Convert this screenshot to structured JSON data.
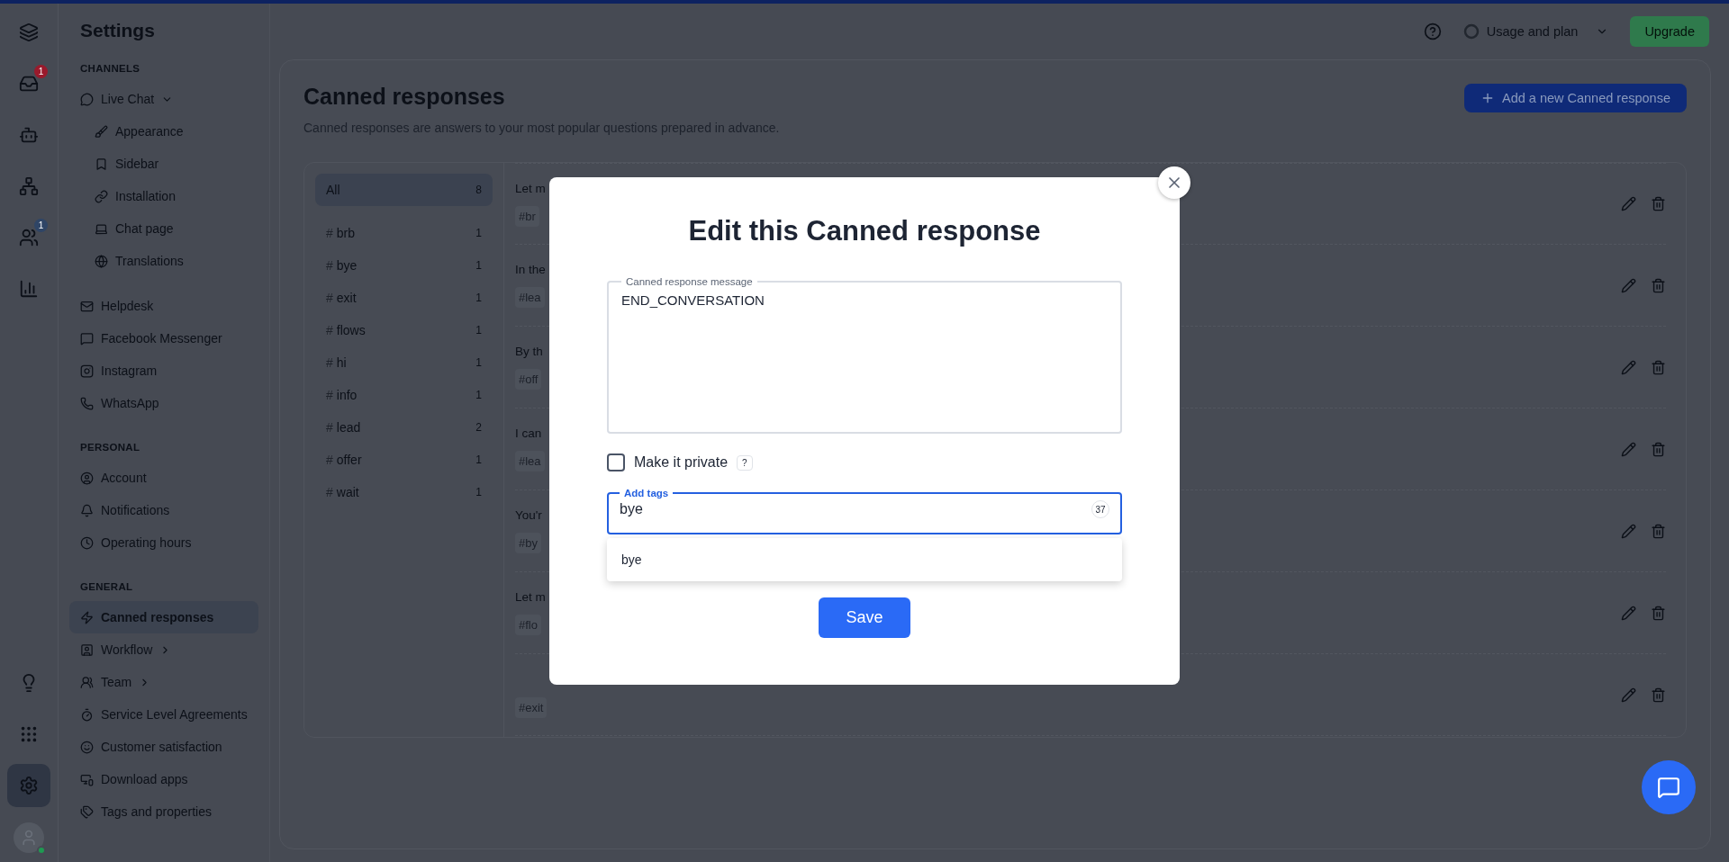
{
  "rail": {
    "top": [
      {
        "selected": false
      },
      {
        "selected": false,
        "badge": "1"
      },
      {
        "selected": false
      },
      {
        "selected": false
      },
      {
        "selected": false,
        "badge": "1"
      },
      {
        "selected": false
      }
    ],
    "bottom": [
      {
        "selected": false
      },
      {
        "selected": false
      },
      {
        "selected": true
      }
    ],
    "avatar": {
      "online": true
    }
  },
  "sidebar": {
    "title": "Settings",
    "sections": [
      {
        "heading": "CHANNELS",
        "items": [
          {
            "label": "Live Chat",
            "selected": false,
            "expanded": true,
            "children": [
              {
                "label": "Appearance",
                "selected": false
              },
              {
                "label": "Sidebar",
                "selected": false
              },
              {
                "label": "Installation",
                "selected": false
              },
              {
                "label": "Chat page",
                "selected": false
              },
              {
                "label": "Translations",
                "selected": false
              }
            ]
          },
          {
            "label": "Helpdesk",
            "selected": false
          },
          {
            "label": "Facebook Messenger",
            "selected": false
          },
          {
            "label": "Instagram",
            "selected": false
          },
          {
            "label": "WhatsApp",
            "selected": false
          }
        ]
      },
      {
        "heading": "PERSONAL",
        "items": [
          {
            "label": "Account",
            "selected": false
          },
          {
            "label": "Notifications",
            "selected": false
          },
          {
            "label": "Operating hours",
            "selected": false
          }
        ]
      },
      {
        "heading": "GENERAL",
        "items": [
          {
            "label": "Canned responses",
            "selected": true
          },
          {
            "label": "Workflow",
            "selected": false,
            "expanded": false
          },
          {
            "label": "Team",
            "selected": false,
            "expanded": false
          },
          {
            "label": "Service Level Agreements",
            "selected": false
          },
          {
            "label": "Customer satisfaction",
            "selected": false
          },
          {
            "label": "Download apps",
            "selected": false
          },
          {
            "label": "Tags and properties",
            "selected": false
          }
        ]
      }
    ]
  },
  "top_bar": {
    "usage": "Usage and plan",
    "upgrade": "Upgrade"
  },
  "page": {
    "title": "Canned responses",
    "subtitle": "Canned responses are answers to your most popular questions prepared in advance.",
    "add_button": "Add a new Canned response"
  },
  "tag_filters": [
    {
      "label": "All",
      "count": "8",
      "selected": true
    },
    {
      "prefix": "#",
      "label": "brb",
      "count": "1",
      "selected": false
    },
    {
      "prefix": "#",
      "label": "bye",
      "count": "1",
      "selected": false
    },
    {
      "prefix": "#",
      "label": "exit",
      "count": "1",
      "selected": false
    },
    {
      "prefix": "#",
      "label": "flows",
      "count": "1",
      "selected": false
    },
    {
      "prefix": "#",
      "label": "hi",
      "count": "1",
      "selected": false
    },
    {
      "prefix": "#",
      "label": "info",
      "count": "1",
      "selected": false
    },
    {
      "prefix": "#",
      "label": "lead",
      "count": "2",
      "selected": false
    },
    {
      "prefix": "#",
      "label": "offer",
      "count": "1",
      "selected": false
    },
    {
      "prefix": "#",
      "label": "wait",
      "count": "1",
      "selected": false
    }
  ],
  "responses": [
    {
      "text": "Let m",
      "tag": "#br"
    },
    {
      "text": "In the",
      "tag": "#lea"
    },
    {
      "text": "By th",
      "tag": "#off"
    },
    {
      "text": "I can",
      "tag": "#lea"
    },
    {
      "text": "You'r",
      "tag": "#by"
    },
    {
      "text": "Let m",
      "tag": "#flo"
    },
    {
      "tag": "#exit"
    }
  ],
  "modal": {
    "title": "Edit this Canned response",
    "message_label": "Canned response message",
    "message": "END_CONVERSATION",
    "private": {
      "label": "Make it private",
      "checked": false,
      "help": "?"
    },
    "tags_field": {
      "label": "Add tags",
      "value": "bye",
      "counter": "37",
      "focused": true
    },
    "suggestions": [
      "bye"
    ],
    "save": "Save"
  }
}
